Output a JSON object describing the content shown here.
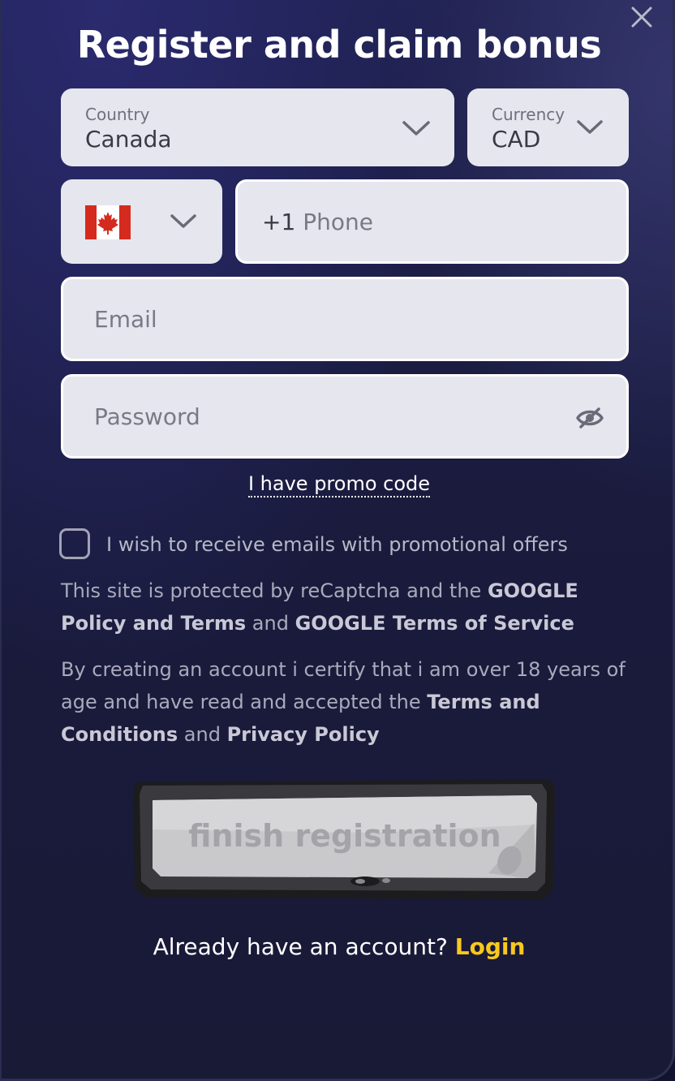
{
  "modal": {
    "title": "Register and claim bonus",
    "close_icon": "close-icon"
  },
  "country": {
    "label": "Country",
    "value": "Canada"
  },
  "currency": {
    "label": "Currency",
    "value": "CAD"
  },
  "phone": {
    "flag_icon": "canada-flag-icon",
    "prefix": "+1",
    "placeholder": "Phone"
  },
  "email": {
    "placeholder": "Email"
  },
  "password": {
    "placeholder": "Password",
    "toggle_icon": "eye-slash-icon"
  },
  "promo": {
    "link_text": "I have promo code"
  },
  "consent": {
    "checked": false,
    "label": "I wish to receive emails with promotional offers"
  },
  "legal": {
    "recaptcha_text_1": "This site is protected by reCaptcha and the ",
    "recaptcha_link_1": "GOOGLE Policy and Terms",
    "recaptcha_text_2": " and ",
    "recaptcha_link_2": "GOOGLE Terms of Service",
    "terms_text_1": "By creating an account i certify that i am over 18 years of age and have read and accepted the ",
    "terms_link_1": "Terms and Conditions",
    "terms_text_2": " and ",
    "terms_link_2": "Privacy Policy"
  },
  "submit": {
    "label": "finish registration"
  },
  "footer": {
    "question": "Already have an account? ",
    "login_label": "Login"
  },
  "colors": {
    "accent_yellow": "#f8c81e",
    "field_background": "#e6e6ee",
    "modal_background": "#1b1c40"
  }
}
